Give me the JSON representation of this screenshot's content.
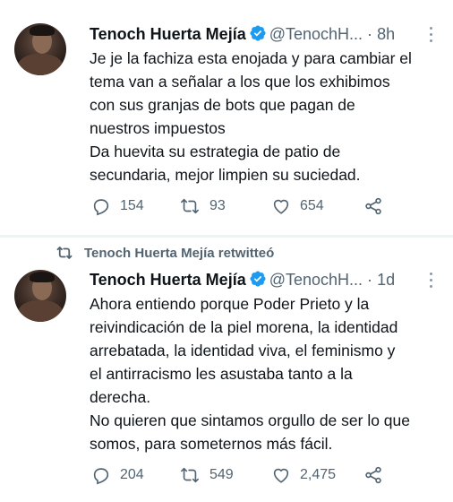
{
  "tweets": [
    {
      "name": "Tenoch Huerta Mejía",
      "handle": "@TenochH...",
      "dot": "·",
      "time": "8h",
      "text_lines": [
        "Je je la fachiza esta enojada y para cambiar el",
        "tema van a señalar a los que los exhibimos",
        "con sus granjas de bots que pagan de",
        "nuestros impuestos",
        "Da huevita su estrategia de patio de",
        "secundaria, mejor limpien su suciedad."
      ],
      "replies": "154",
      "retweets": "93",
      "likes": "654"
    },
    {
      "retweeted_by": "Tenoch Huerta Mejía retwitteó",
      "name": "Tenoch Huerta Mejía",
      "handle": "@TenochH...",
      "dot": "·",
      "time": "1d",
      "text_lines": [
        "Ahora entiendo porque Poder Prieto y la",
        "reivindicación de la piel morena, la identidad",
        "arrebatada, la identidad viva, el feminismo y",
        "el antirracismo les asustaba tanto a la",
        "derecha.",
        "No quieren que sintamos orgullo de ser lo que",
        "somos, para someternos más fácil."
      ],
      "replies": "204",
      "retweets": "549",
      "likes": "2,475"
    }
  ],
  "icons": {
    "verified": "verified-badge-icon",
    "reply": "reply-icon",
    "retweet": "retweet-icon",
    "like": "heart-icon",
    "share": "share-icon",
    "more": "more-options-icon"
  },
  "colors": {
    "verified": "#1d9bf0",
    "text": "#0f1419",
    "secondary": "#536471",
    "separator": "#eff3f4"
  }
}
